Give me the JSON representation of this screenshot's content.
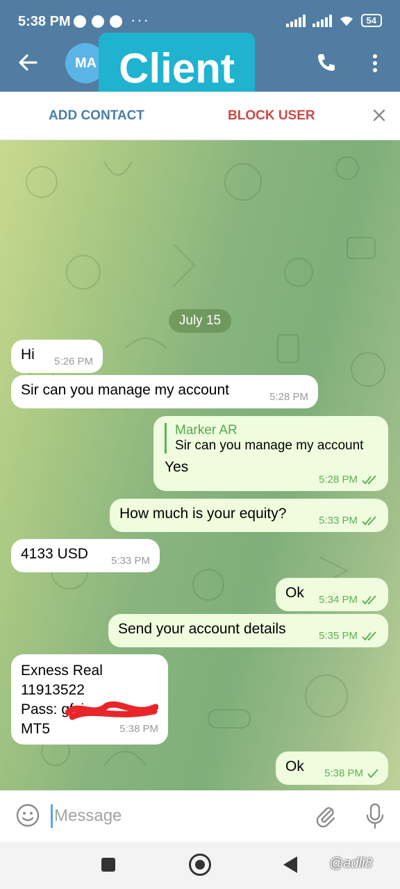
{
  "status_bar": {
    "time": "5:38 PM",
    "more_indicator": "···",
    "battery": "54"
  },
  "header": {
    "avatar_initials": "MA",
    "title_overlay": "Client"
  },
  "action_bar": {
    "add_contact": "ADD CONTACT",
    "block_user": "BLOCK USER"
  },
  "chat": {
    "date_chip": "July 15",
    "messages": [
      {
        "direction": "in",
        "text": "Hi",
        "time": "5:26 PM"
      },
      {
        "direction": "in",
        "text": "Sir can you manage my account",
        "time": "5:28 PM"
      },
      {
        "direction": "out",
        "reply_to_name": "Marker AR",
        "reply_to_text": "Sir can you manage my account",
        "text": "Yes",
        "time": "5:28 PM",
        "status": "read"
      },
      {
        "direction": "out",
        "text": "How much is your equity?",
        "time": "5:33 PM",
        "status": "read"
      },
      {
        "direction": "in",
        "text": "4133 USD",
        "time": "5:33 PM"
      },
      {
        "direction": "out",
        "text": "Ok",
        "time": "5:34 PM",
        "status": "read"
      },
      {
        "direction": "out",
        "text": "Send your account details",
        "time": "5:35 PM",
        "status": "read"
      },
      {
        "direction": "in",
        "lines": [
          "Exness Real",
          "11913522",
          "Pass: gfyi",
          "MT5"
        ],
        "time": "5:38 PM"
      },
      {
        "direction": "out",
        "text": "Ok",
        "time": "5:38 PM",
        "status": "sent"
      }
    ]
  },
  "input": {
    "placeholder": "Message"
  },
  "watermark": "@adli8",
  "colors": {
    "header": "#517da2",
    "outgoing_bubble": "#effdde",
    "incoming_bubble": "#ffffff",
    "block_user": "#c94a46",
    "add_contact": "#4a7ea6",
    "badge": "#1fb3cf"
  }
}
